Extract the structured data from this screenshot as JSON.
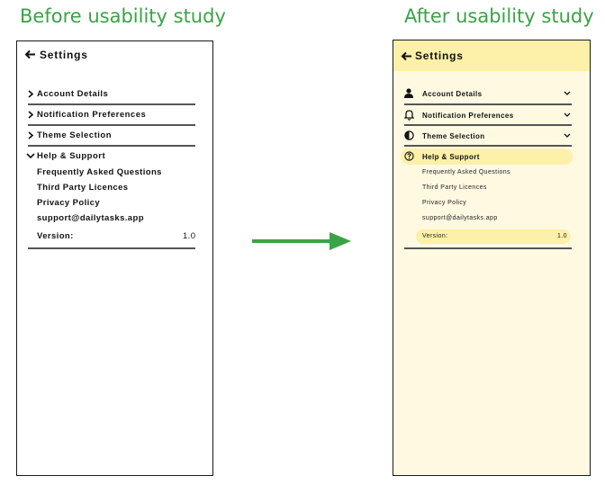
{
  "captions": {
    "before": "Before usability study",
    "after": "After usability study"
  },
  "before": {
    "title": "Settings",
    "items": [
      {
        "label": "Account Details"
      },
      {
        "label": "Notification Preferences"
      },
      {
        "label": "Theme Selection"
      },
      {
        "label": "Help & Support"
      }
    ],
    "sub_items": [
      {
        "label": "Frequently Asked Questions"
      },
      {
        "label": "Third Party Licences"
      },
      {
        "label": "Privacy Policy"
      },
      {
        "label": "support@dailytasks.app"
      }
    ],
    "version": {
      "label": "Version:",
      "value": "1.0"
    }
  },
  "after": {
    "title": "Settings",
    "items": [
      {
        "label": "Account Details",
        "icon": "person-icon"
      },
      {
        "label": "Notification Preferences",
        "icon": "bell-icon"
      },
      {
        "label": "Theme Selection",
        "icon": "contrast-icon"
      },
      {
        "label": "Help & Support",
        "icon": "help-circle-icon"
      }
    ],
    "sub_items": [
      {
        "label": "Frequently Asked Questions"
      },
      {
        "label": "Third Party Licences"
      },
      {
        "label": "Privacy Policy"
      },
      {
        "label": "support@dailytasks.app"
      }
    ],
    "version": {
      "label": "Version:",
      "value": "1.0"
    }
  },
  "colors": {
    "caption": "#3aa345",
    "after_background": "#fff9e2",
    "after_highlight": "#fdf0a8",
    "arrow": "#3aa345"
  }
}
